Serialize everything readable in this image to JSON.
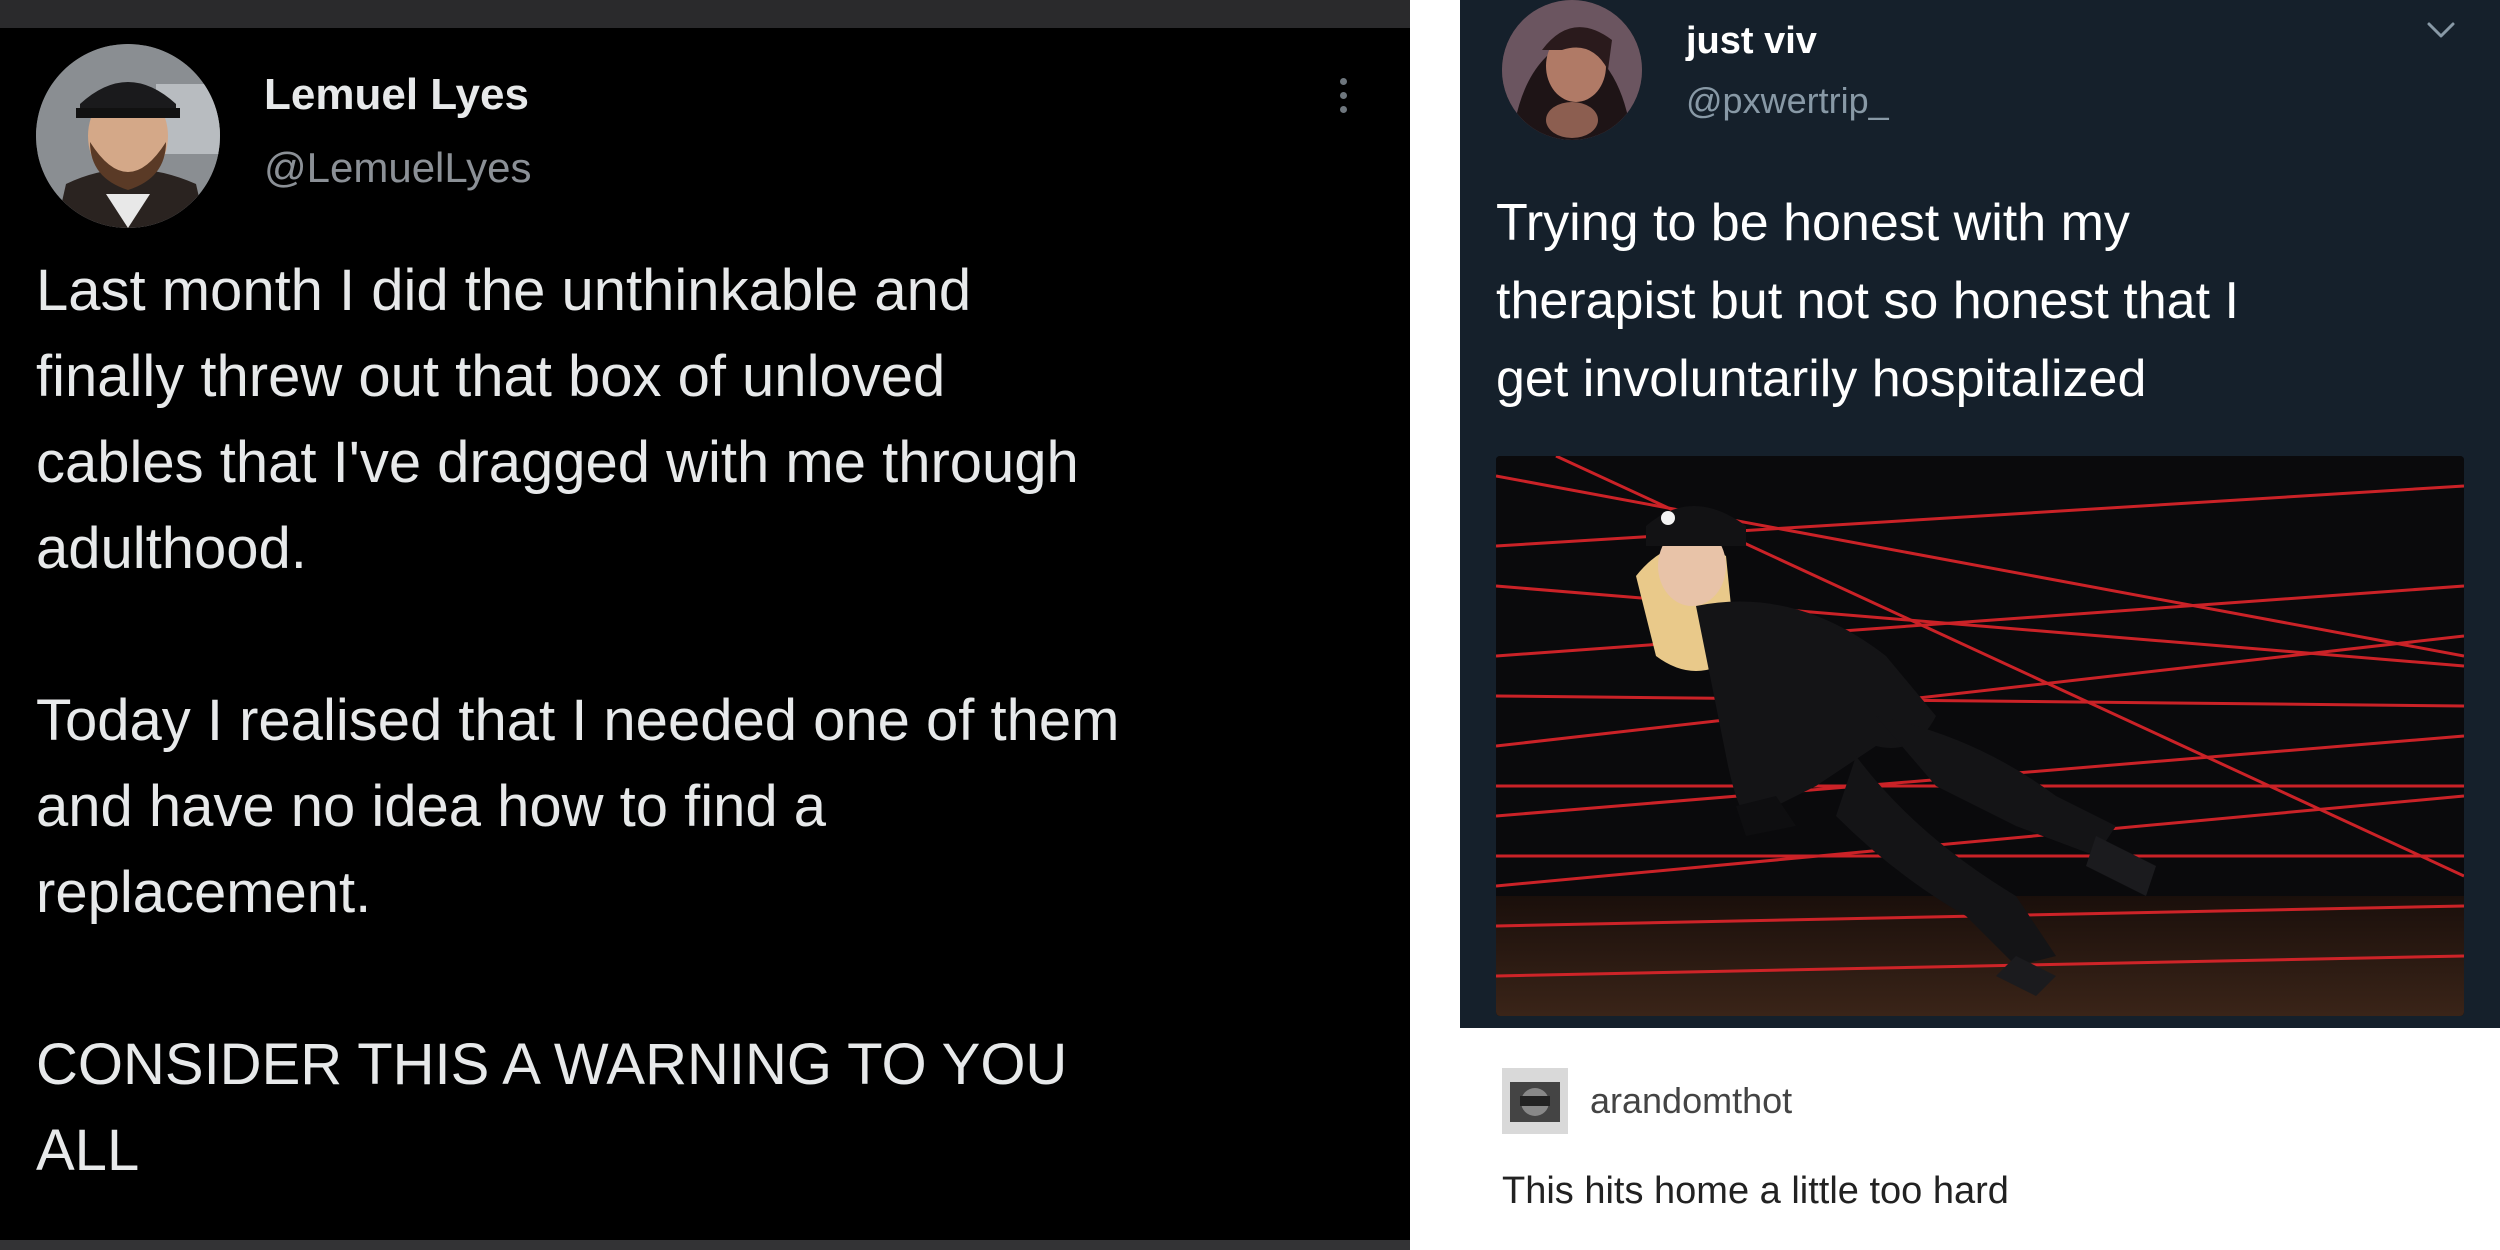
{
  "left_tweet": {
    "author_name": "Lemuel Lyes",
    "author_handle": "@LemuelLyes",
    "more_icon": "kebab-menu-icon",
    "paragraphs": [
      "Last month I did the unthinkable and\nfinally threw out that box of unloved\ncables that I've dragged with me through\nadulthood.",
      "Today I realised that I needed one of them\nand have no idea how to find a\nreplacement.",
      "CONSIDER THIS A WARNING TO YOU\nALL"
    ]
  },
  "right_tweet": {
    "author_name": "just viv",
    "author_handle": "@pxwertrip_",
    "menu_icon": "chevron-down-icon",
    "text": "Trying to be honest with my\ntherapist but not so honest that I\nget involuntarily hospitalized"
  },
  "tumblr_reply": {
    "username": "arandomthot",
    "comment": "This hits home a little too hard"
  },
  "colors": {
    "left_bg": "#000000",
    "right_card_bg": "#15202b",
    "laser_red": "#e0252b"
  }
}
